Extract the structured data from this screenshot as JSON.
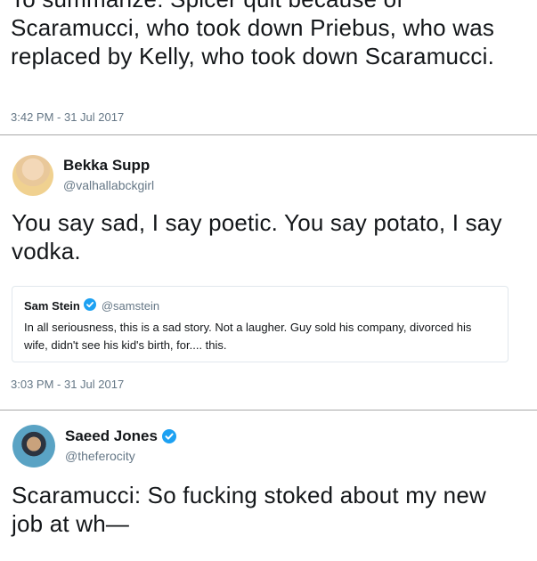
{
  "tweets": [
    {
      "text": "To summarize: Spicer quit because of Scaramucci, who took down Priebus, who was replaced by Kelly, who took down Scaramucci.",
      "timestamp": "3:42 PM - 31 Jul 2017"
    },
    {
      "name": "Bekka Supp",
      "handle": "@valhallabckgirl",
      "text": "You say sad, I say poetic. You say potato, I say vodka.",
      "quote": {
        "name": "Sam Stein",
        "handle": "@samstein",
        "text": "In all seriousness, this is a sad story. Not a laugher. Guy sold his company, divorced his wife, didn't see his kid's birth, for.... this."
      },
      "timestamp": "3:03 PM - 31 Jul 2017"
    },
    {
      "name": "Saeed Jones",
      "handle": "@theferocity",
      "text": "Scaramucci: So fucking stoked about my new job at wh—"
    }
  ],
  "colors": {
    "verified": "#1da1f2",
    "muted": "#657786",
    "text": "#14171a"
  }
}
